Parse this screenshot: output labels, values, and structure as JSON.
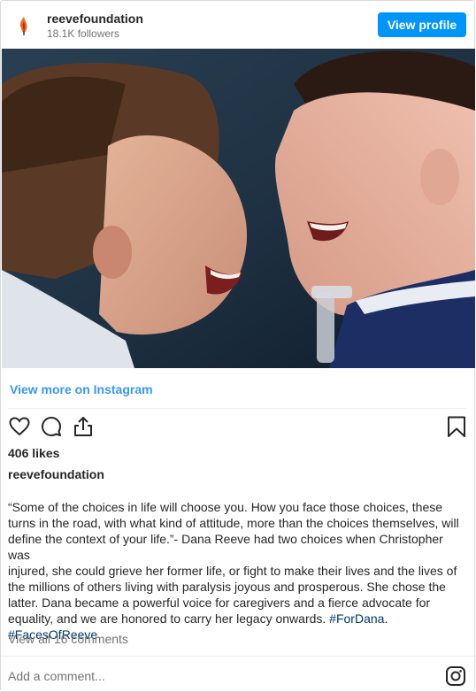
{
  "post": {
    "account": {
      "handle": "reevefoundation",
      "followers": "18.1K followers",
      "view_profile_label": "View profile"
    },
    "photo": {
      "alt": "A woman and a man smiling at each other face to face"
    },
    "view_more_label": "View more on Instagram",
    "likes": "406 likes",
    "author": "reevefoundation",
    "caption": {
      "lines": [
        "“Some of the choices in life will choose you. How you face those choices, these",
        "turns in the road, with what kind of attitude, more than the choices themselves, will",
        "define the context of your life.”- Dana Reeve had two choices when Christopher was",
        "injured, she could grieve her former life, or fight to make their lives and the lives of",
        "the millions of others living with paralysis joyous and prosperous. She chose the",
        "latter. Dana became a powerful voice for caregivers and a fierce advocate for",
        "equality, and we are honored to carry her legacy onwards. "
      ],
      "hashtag_1": "#ForDana",
      "after_hashtag_1": ".",
      "hashtag_2": "#FacesOfReeve"
    },
    "view_comments_label": "View all 16 comments",
    "add_comment_placeholder": "Add a comment...",
    "icons": {
      "like": "heart-icon",
      "comment": "comment-icon",
      "share": "share-icon",
      "save": "bookmark-icon",
      "instagram": "instagram-icon",
      "avatar": "flame-icon"
    },
    "colors": {
      "button": "#0095f6",
      "link": "#3897f0",
      "hashtag": "#00376b"
    }
  }
}
